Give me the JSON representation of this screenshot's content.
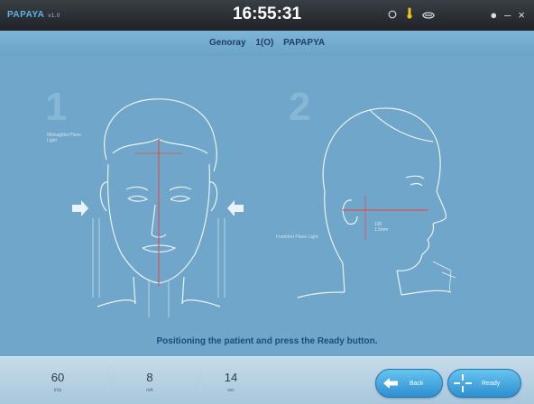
{
  "titlebar": {
    "app_name": "PAPAYA",
    "app_version": "v1.0",
    "clock": "16:55:31",
    "icons": [
      "target-icon",
      "thermometer-icon",
      "link-icon"
    ],
    "window_controls": {
      "settings": "●",
      "minimize": "–",
      "close": "×"
    }
  },
  "header": {
    "company": "Genoray",
    "model": "1(O)",
    "product": "PAPAPYA"
  },
  "steps": [
    {
      "number": "1",
      "label": "Midsagittal Plane Light"
    },
    {
      "number": "2",
      "label": "Frankfort Plane Light"
    }
  ],
  "instruction": "Positioning the patient and press the Ready button.",
  "params": [
    {
      "value": "60",
      "unit": "kVp"
    },
    {
      "value": "8",
      "unit": "mA"
    },
    {
      "value": "14",
      "unit": "sec"
    }
  ],
  "buttons": {
    "back_label": "Back",
    "ready_label": "Ready"
  },
  "colors": {
    "background": "#6fa6c9",
    "titlebar": "#1f2226",
    "guide_line": "#d9534f",
    "button": "#2d8fd0"
  }
}
